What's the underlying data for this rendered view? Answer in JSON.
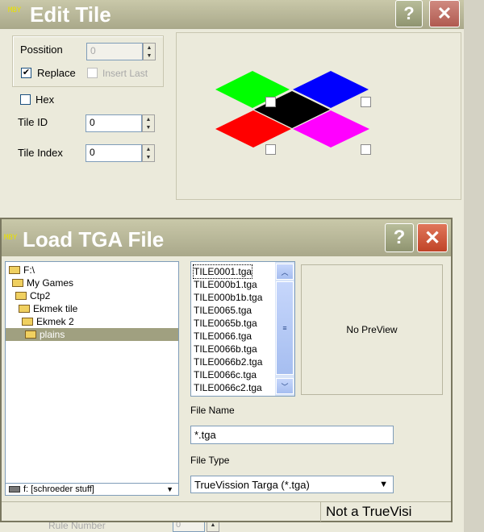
{
  "edit_tile": {
    "title": "Edit Tile",
    "logo": "MBY",
    "help": "?",
    "close": "✕",
    "possition_label": "Possition",
    "possition_value": "0",
    "replace_label": "Replace",
    "replace_checked": "✔",
    "insert_last_label": "Insert Last",
    "hex_label": "Hex",
    "tile_id_label": "Tile ID",
    "tile_id_value": "0",
    "tile_index_label": "Tile Index",
    "tile_index_value": "0",
    "rule_number_label": "Rule Number",
    "rule_number_value": "0",
    "tile_colors": [
      "#00ff00",
      "#0000ff",
      "#000000",
      "#ff0000",
      "#ff00ff"
    ]
  },
  "load_tga": {
    "title": "Load TGA File",
    "logo": "MBY",
    "help": "?",
    "close": "✕",
    "tree": [
      "F:\\",
      "My Games",
      "Ctp2",
      "Ekmek tile",
      "Ekmek 2",
      "plains"
    ],
    "files": [
      "TILE0001.tga",
      "TILE000b1.tga",
      "TILE000b1b.tga",
      "TILE0065.tga",
      "TILE0065b.tga",
      "TILE0066.tga",
      "TILE0066b.tga",
      "TILE0066b2.tga",
      "TILE0066c.tga",
      "TILE0066c2.tga"
    ],
    "preview_text": "No PreView",
    "file_name_label": "File Name",
    "file_name_value": "*.tga",
    "file_type_label": "File Type",
    "file_type_value": "TrueVission Targa (*.tga)",
    "drive_value": "f: [schroeder stuff]",
    "status_text": "Not a TrueVisi"
  }
}
